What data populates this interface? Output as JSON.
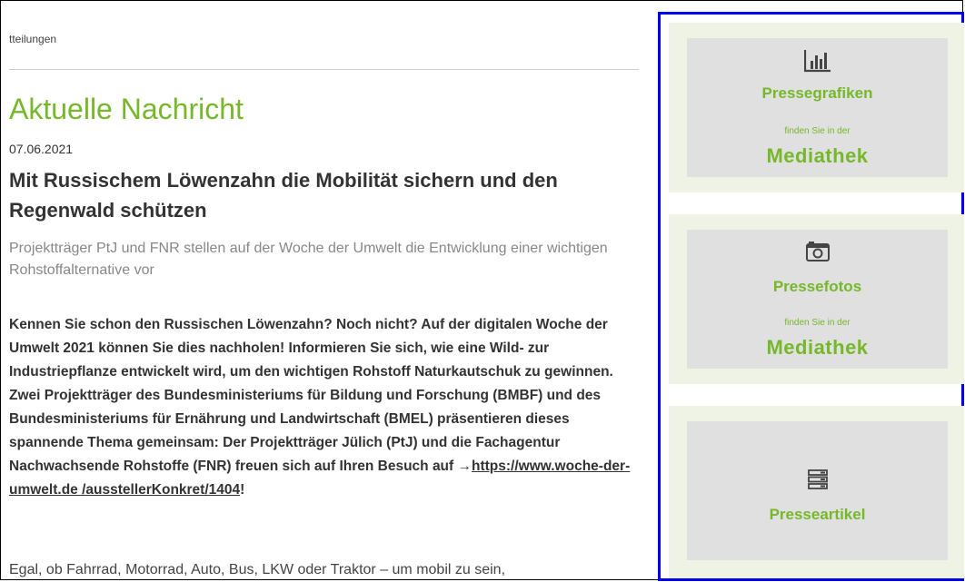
{
  "breadcrumb": "tteilungen",
  "article": {
    "section_title": "Aktuelle Nachricht",
    "date": "07.06.2021",
    "headline": "Mit Russischem Löwenzahn die Mobilität sichern und den Regenwald schützen",
    "subtitle": "Projektträger PtJ und FNR stellen auf der Woche der Umwelt die Entwicklung einer wichtigen Rohstoffalternative vor",
    "intro": "Kennen Sie schon den Russischen Löwenzahn? Noch nicht? Auf der digitalen Woche der Umwelt 2021 können Sie dies nachholen! Informieren Sie sich, wie eine Wild- zur Industriepflanze entwickelt wird, um den wichtigen Rohstoff Naturkautschuk zu gewinnen. Zwei Projektträger des Bundesministeriums für Bildung und Forschung (BMBF) und des Bundesministeriums für Ernährung und Landwirtschaft (BMEL) präsentieren dieses spannende Thema gemeinsam: Der Projektträger Jülich (PtJ) und die Fachagentur Nachwachsende Rohstoffe (FNR) freuen sich auf Ihren Besuch auf ",
    "link_arrow": "→",
    "link_text": "https://www.woche-der-umwelt.de /ausstellerKonkret/1404",
    "intro_end": "!",
    "body_start": "Egal, ob Fahrrad, Motorrad, Auto, Bus, LKW oder Traktor – um mobil zu sein,"
  },
  "sidebar": {
    "cards": [
      {
        "icon": "bar-chart-icon",
        "title": "Pressegrafiken",
        "small": "finden Sie in der",
        "big": "Mediathek"
      },
      {
        "icon": "camera-icon",
        "title": "Pressefotos",
        "small": "finden Sie in der",
        "big": "Mediathek"
      },
      {
        "icon": "server-stack-icon",
        "title": "Presseartikel"
      }
    ]
  },
  "colors": {
    "accent_green": "#76b82a",
    "card_bg": "#e0e0e0",
    "card_outer_bg": "#eef3e6",
    "highlight_border": "#0000ee"
  }
}
